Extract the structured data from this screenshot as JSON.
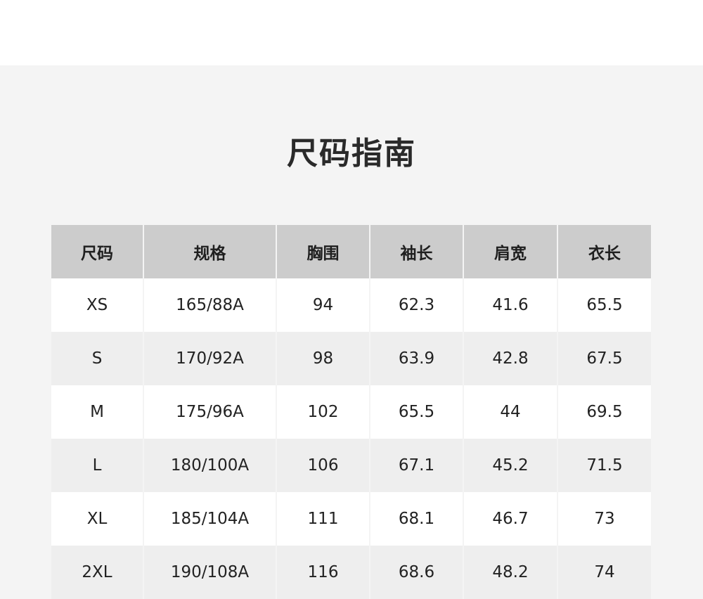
{
  "page": {
    "title": "尺码指南"
  },
  "size_table": {
    "headers": [
      "尺码",
      "规格",
      "胸围",
      "袖长",
      "肩宽",
      "衣长"
    ],
    "rows": [
      [
        "XS",
        "165/88A",
        "94",
        "62.3",
        "41.6",
        "65.5"
      ],
      [
        "S",
        "170/92A",
        "98",
        "63.9",
        "42.8",
        "67.5"
      ],
      [
        "M",
        "175/96A",
        "102",
        "65.5",
        "44",
        "69.5"
      ],
      [
        "L",
        "180/100A",
        "106",
        "67.1",
        "45.2",
        "71.5"
      ],
      [
        "XL",
        "185/104A",
        "111",
        "68.1",
        "46.7",
        "73"
      ],
      [
        "2XL",
        "190/108A",
        "116",
        "68.6",
        "48.2",
        "74"
      ]
    ]
  },
  "colors": {
    "background": "#f4f4f4",
    "header_bg": "#cccccc",
    "row_odd": "#ffffff",
    "row_even": "#eeeeee",
    "text": "#222222"
  }
}
